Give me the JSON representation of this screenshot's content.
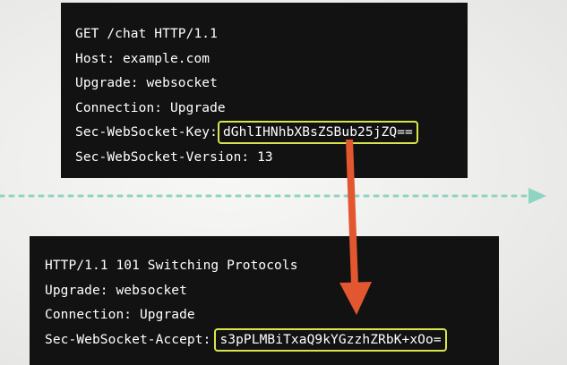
{
  "request": {
    "lines": [
      "GET /chat HTTP/1.1",
      "Host: example.com",
      "Upgrade: websocket",
      "Connection: Upgrade"
    ],
    "key_label": "Sec-WebSocket-Key:",
    "key_value": "dGhlIHNhbXBsZSBub25jZQ==",
    "version_line": "Sec-WebSocket-Version: 13"
  },
  "response": {
    "lines": [
      "HTTP/1.1 101 Switching Protocols",
      "Upgrade: websocket",
      "Connection: Upgrade"
    ],
    "accept_label": "Sec-WebSocket-Accept:",
    "accept_value": "s3pPLMBiTxaQ9kYGzzhZRbK+xOo="
  },
  "colors": {
    "panel_background": "#121212",
    "highlight_border": "#d9e64a",
    "arrow": "#e2572f",
    "dotted_line": "#8fd3c3"
  }
}
